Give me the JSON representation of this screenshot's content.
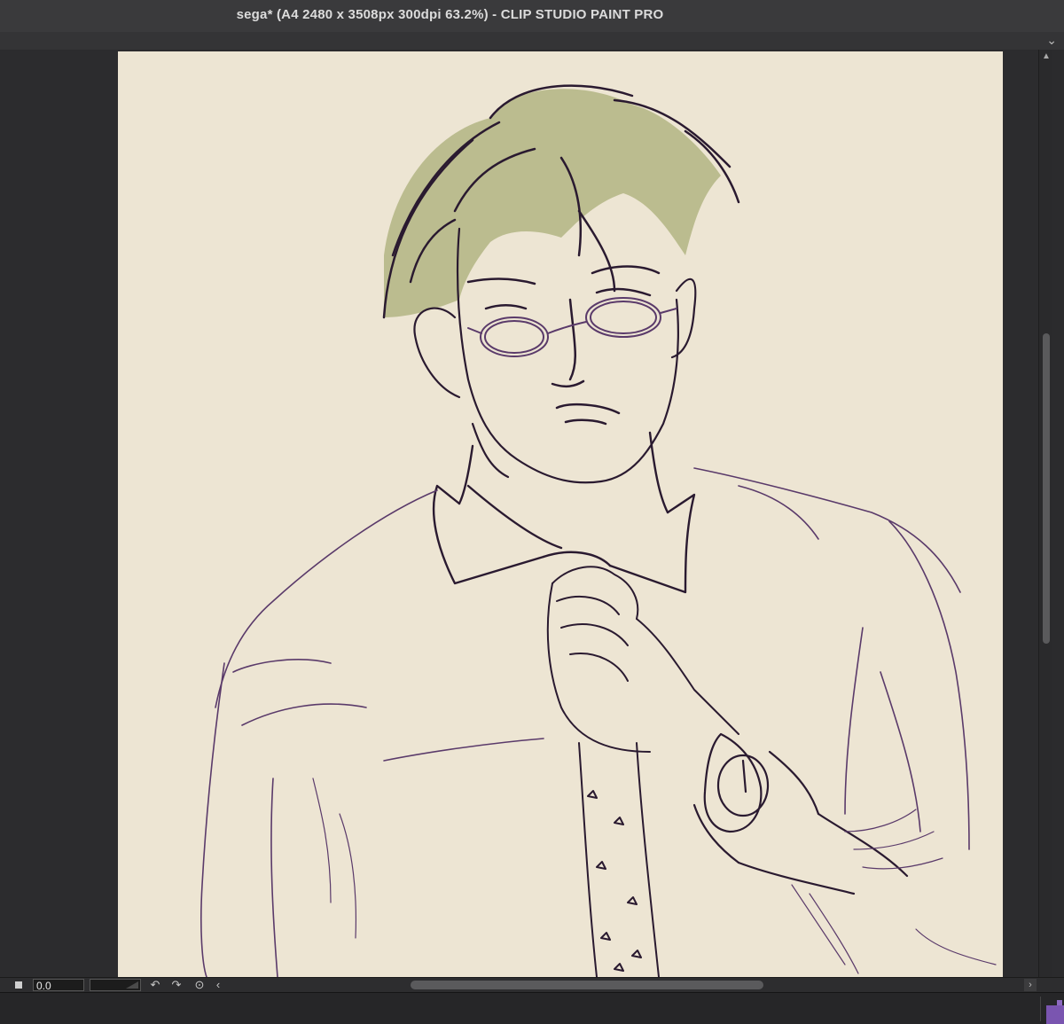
{
  "window": {
    "title": "sega* (A4 2480 x 3508px 300dpi 63.2%)  - CLIP STUDIO PAINT PRO",
    "expand_icon": "chevron-down-icon"
  },
  "statusbar": {
    "rotation_value": "0.0",
    "icons": [
      "stop-icon",
      "rotate-left-icon",
      "rotate-right-icon",
      "reset-rotation-icon",
      "scroll-left-icon",
      "scroll-right-icon"
    ]
  },
  "colors": {
    "canvas_paper": "#ede5d3",
    "hair": "#a9b07a",
    "line_dark": "#2a1a30",
    "line_purple": "#5a3a6a",
    "ui_dark": "#2b2b2d",
    "accent": "#7a55b0"
  }
}
